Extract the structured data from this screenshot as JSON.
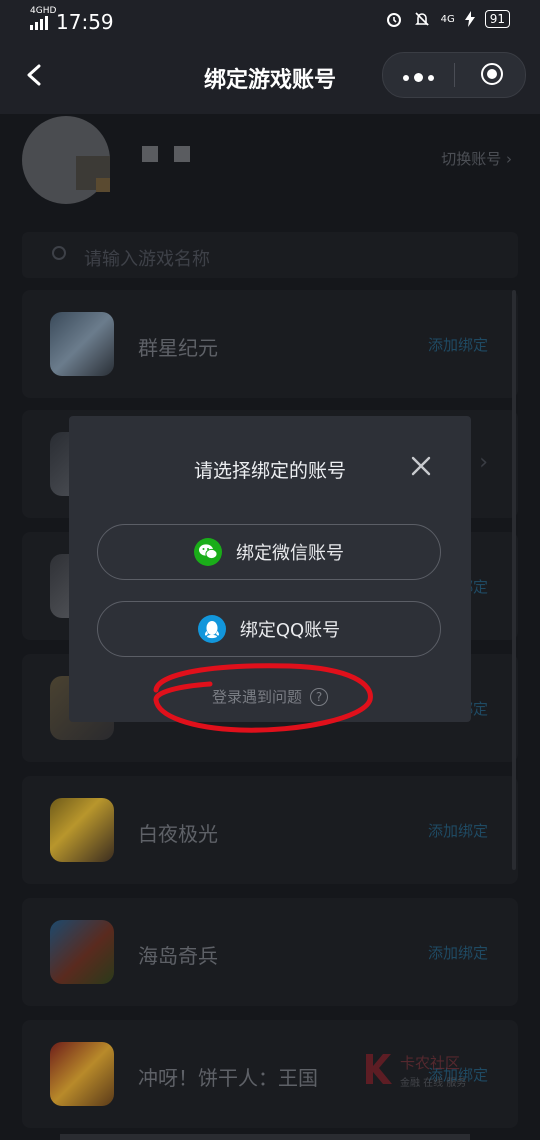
{
  "status_bar": {
    "network": "4GHD",
    "time": "17:59",
    "network_right": "4G",
    "battery": "91"
  },
  "nav": {
    "title": "绑定游戏账号"
  },
  "profile": {
    "switch_account": "切换账号"
  },
  "search": {
    "placeholder": "请输入游戏名称"
  },
  "games": [
    {
      "name": "群星纪元",
      "action": "添加绑定"
    },
    {
      "name": "",
      "action": ""
    },
    {
      "name": "",
      "action": "添加绑定"
    },
    {
      "name": "",
      "action": "添加绑定"
    },
    {
      "name": "白夜极光",
      "action": "添加绑定"
    },
    {
      "name": "海岛奇兵",
      "action": "添加绑定"
    },
    {
      "name": "冲呀！饼干人：王国",
      "action": "添加绑定"
    }
  ],
  "modal": {
    "title": "请选择绑定的账号",
    "wechat_button": "绑定微信账号",
    "qq_button": "绑定QQ账号",
    "help_text": "登录遇到问题"
  },
  "watermark": {
    "text": "卡农社区",
    "sub": "金融 在线 服务"
  },
  "colors": {
    "background": "#15171b",
    "modal": "#2d3037",
    "wechat": "#1aad19",
    "qq": "#1296db",
    "annotation": "#e0101b"
  }
}
